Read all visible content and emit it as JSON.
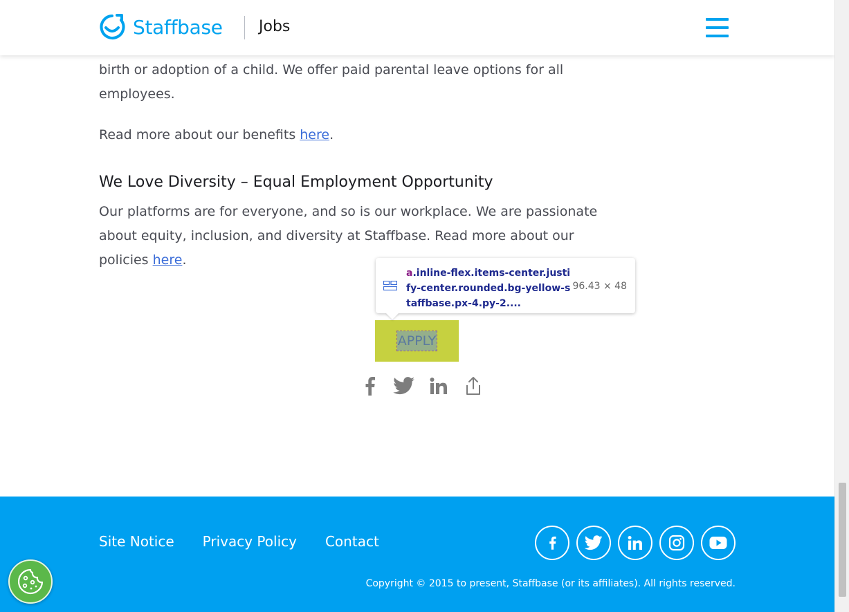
{
  "header": {
    "brand": "Staffbase",
    "section": "Jobs"
  },
  "content": {
    "para1": "birth or adoption of a child. We offer paid parental leave options for all employees.",
    "benefits_prefix": "Read more about our benefits ",
    "benefits_link": "here",
    "benefits_suffix": ".",
    "heading": "We Love Diversity – Equal Employment Opportunity",
    "para2": "Our platforms are for everyone, and so is our workplace. We are passionate about equity, inclusion, and diversity at Staffbase. Read more about our policies ",
    "policies_link": "here",
    "policies_suffix": "."
  },
  "apply": {
    "label": "APPLY"
  },
  "tooltip": {
    "tag": "a",
    "classes": ".inline-flex.items-center.justify-center.rounded.bg-yellow-staffbase.px-4.py-2....",
    "dimensions": "96.43 × 48"
  },
  "share": {
    "icons": [
      "facebook-icon",
      "twitter-icon",
      "linkedin-icon",
      "share-icon"
    ]
  },
  "footer": {
    "links": [
      "Site Notice",
      "Privacy Policy",
      "Contact"
    ],
    "social": [
      "facebook",
      "twitter",
      "linkedin",
      "instagram",
      "youtube"
    ],
    "copyright": "Copyright © 2015 to present, Staffbase (or its affiliates). All rights reserved."
  },
  "colors": {
    "brand_blue": "#00a3ef",
    "apply_yellow": "#c6d140",
    "footer_blue": "#00a0f0",
    "cookie_green": "#5bb84a"
  }
}
